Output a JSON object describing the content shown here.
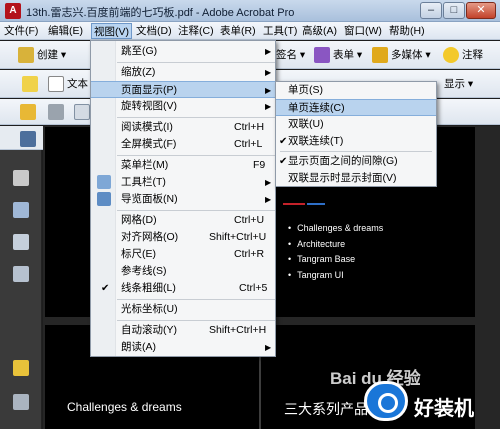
{
  "window": {
    "title": "13th.雷志兴.百度前端的七巧板.pdf - Adobe Acrobat Pro",
    "buttons": {
      "minimize": "–",
      "maximize": "□",
      "close": "✕"
    }
  },
  "menubar": {
    "items": [
      {
        "label": "文件(F)"
      },
      {
        "label": "编辑(E)"
      },
      {
        "label": "视图(V)",
        "active": true
      },
      {
        "label": "文档(D)"
      },
      {
        "label": "注释(C)"
      },
      {
        "label": "表单(R)"
      },
      {
        "label": "工具(T)"
      },
      {
        "label": "高级(A)"
      },
      {
        "label": "窗口(W)"
      },
      {
        "label": "帮助(H)"
      }
    ]
  },
  "toolbar": {
    "create_label": "创建",
    "text_label": "文本",
    "sign_label": "签名",
    "forms_label": "表单",
    "multimedia_label": "多媒体",
    "comment_label": "注释",
    "display_label": "显示"
  },
  "view_menu": {
    "items": [
      {
        "label": "跳至(G)",
        "arrow": true
      },
      {
        "label": "缩放(Z)",
        "arrow": true
      },
      {
        "label": "页面显示(P)",
        "arrow": true,
        "highlighted": true
      },
      {
        "label": "旋转视图(V)",
        "arrow": true
      },
      {
        "label": "阅读模式(I)",
        "shortcut": "Ctrl+H"
      },
      {
        "label": "全屏模式(F)",
        "shortcut": "Ctrl+L"
      },
      {
        "label": "菜单栏(M)",
        "shortcut": "F9"
      },
      {
        "label": "工具栏(T)",
        "arrow": true,
        "icon": "toolbar-icon"
      },
      {
        "label": "导览面板(N)",
        "arrow": true,
        "icon": "navigation-panel-icon"
      },
      {
        "label": "网格(D)",
        "shortcut": "Ctrl+U"
      },
      {
        "label": "对齐网格(O)",
        "shortcut": "Shift+Ctrl+U"
      },
      {
        "label": "标尺(E)",
        "shortcut": "Ctrl+R"
      },
      {
        "label": "参考线(S)"
      },
      {
        "label": "线条粗细(L)",
        "shortcut": "Ctrl+5",
        "checked": true
      },
      {
        "label": "光标坐标(U)"
      },
      {
        "label": "自动滚动(Y)",
        "shortcut": "Shift+Ctrl+H"
      },
      {
        "label": "朗读(A)",
        "arrow": true
      }
    ]
  },
  "page_display_submenu": {
    "items": [
      {
        "label": "单页(S)"
      },
      {
        "label": "单页连续(C)",
        "highlighted": true
      },
      {
        "label": "双联(U)"
      },
      {
        "label": "双联连续(T)",
        "checked": true
      },
      {
        "label": "显示页面之间的间隙(G)",
        "checked": true
      },
      {
        "label": "双联显示时显示封面(V)"
      }
    ]
  },
  "document": {
    "bullets": [
      "Challenges & dreams",
      "Architecture",
      "Tangram Base",
      "Tangram UI"
    ],
    "page2_left_title": "Challenges & dreams",
    "page2_right_title": "三大系列产品"
  },
  "watermark": {
    "text": "Bai du 经验",
    "brand": "好装机"
  },
  "colors": {
    "menu_highlight": "#b9d3ee",
    "doc_background": "#000000",
    "accent_red": "#c4222a",
    "accent_blue": "#2e6fc7"
  }
}
